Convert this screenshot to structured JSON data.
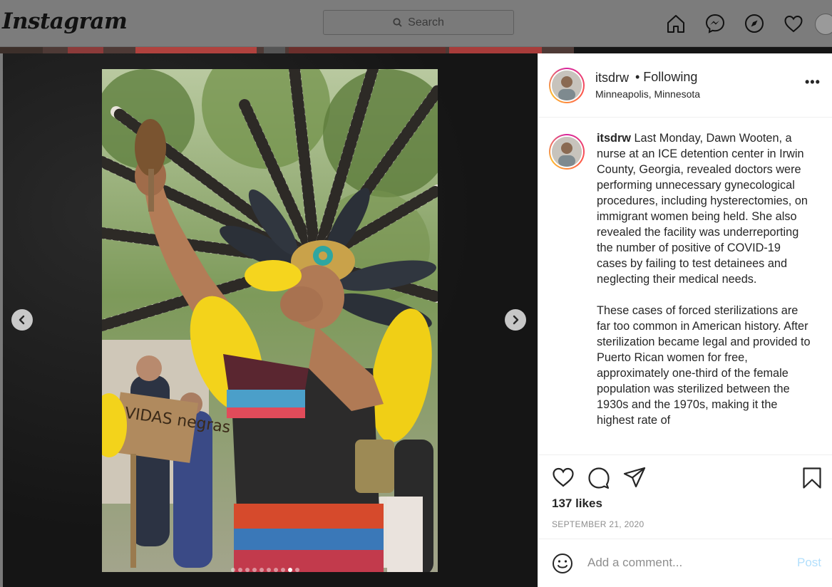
{
  "app": {
    "logo": "Instagram"
  },
  "search": {
    "placeholder": "Search"
  },
  "nav": {
    "icons": [
      "home-icon",
      "messenger-icon",
      "explore-icon",
      "heart-icon",
      "profile-avatar"
    ]
  },
  "post": {
    "username": "itsdrw",
    "follow_status": "• Following",
    "location": "Minneapolis, Minnesota",
    "more_label": "•••",
    "caption_username": "itsdrw",
    "caption_paragraphs": [
      "Last Monday, Dawn Wooten, a nurse at an ICE detention center in Irwin County, Georgia, revealed doctors were performing unnecessary gynecological procedures, including hysterectomies, on immigrant women being held. She also revealed the facility was underreporting the number of positive of COVID-19 cases by failing to test detainees and neglecting their medical needs.",
      "These cases of forced sterilizations are far too common in American history. After sterilization became legal and provided to Puerto Rican women for free, approximately one-third of the female population was sterilized between the 1930s and the 1970s, making it the highest rate of"
    ],
    "likes": "137 likes",
    "date": "SEPTEMBER 21, 2020",
    "comment_placeholder": "Add a comment...",
    "post_button": "Post",
    "carousel": {
      "count": 10,
      "active_index": 8
    },
    "photo_sign_text": "VIDAS negras importan"
  },
  "colors": {
    "post_button": "#b2dffc",
    "story_ring": "#d6249f",
    "secondary_text": "#8e8e8e"
  }
}
